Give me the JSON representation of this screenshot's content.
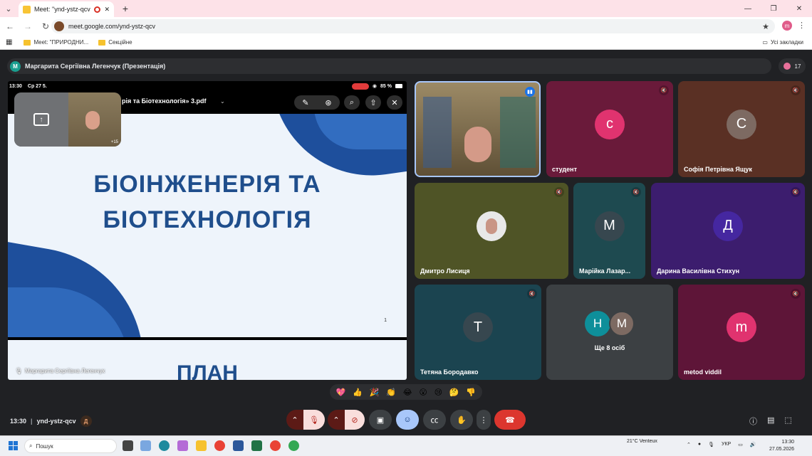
{
  "browser": {
    "tab_title": "Meet: \"ynd-ystz-qcv\"",
    "url": "meet.google.com/ynd-ystz-qcv",
    "profile_initial": "m",
    "bookmarks": [
      {
        "label": "Meet: \"ПРИРОДНИ..."
      },
      {
        "label": "Секційне"
      }
    ],
    "all_bookmarks": "Усі закладки"
  },
  "meet": {
    "presenter_bar": "Маргарита Сергіївна Легенчук (Презентація)",
    "presenter_initial": "M",
    "participant_count": "17",
    "shared_screen": {
      "status_time": "13:30",
      "status_date": "Ср 27 5.",
      "battery": "85 %",
      "doc_name": "рія та Біотехнологія» 3.pdf",
      "slide_title_1": "БІОІНЖЕНЕРІЯ ТА",
      "slide_title_2": "БІОТЕХНОЛОГІЯ",
      "page_number": "1",
      "next_slide_title": "ПЛАН",
      "label": "Маргарита Сергіївна Легенчук",
      "pip_count": "+15"
    },
    "tiles": [
      {
        "name": "",
        "initial": "",
        "color": "#6b5a40"
      },
      {
        "name": "студент",
        "initial": "с",
        "color": "#6a1a3a",
        "av_color": "#e0336f"
      },
      {
        "name": "Софія Петрівна Ящук",
        "initial": "С",
        "color": "#5a3024",
        "av_color": "#7d6a62"
      },
      {
        "name": "Дмитро Лисиця",
        "initial": "",
        "color": "#4f5426"
      },
      {
        "name": "Марійка Лазар...",
        "initial": "М",
        "color": "#1e4a50",
        "av_color": "#37474f"
      },
      {
        "name": "Дарина Василівна Стихун",
        "initial": "Д",
        "color": "#3c1d6e",
        "av_color": "#4527a0"
      },
      {
        "name": "Тетяна Бородавко",
        "initial": "Т",
        "color": "#1b4450",
        "av_color": "#37474f"
      },
      {
        "name": "Ще 8 осіб",
        "initial": "",
        "color": "#3c4043"
      },
      {
        "name": "metod viddil",
        "initial": "m",
        "color": "#5e1538",
        "av_color": "#e0336f"
      }
    ],
    "more_avatars": [
      "Н",
      "М"
    ],
    "emojis": [
      "💖",
      "👍",
      "🎉",
      "👏",
      "😂",
      "😮",
      "😢",
      "🤔",
      "👎"
    ],
    "meeting_time": "13:30",
    "meeting_code": "ynd-ystz-qcv",
    "meeting_badge": "Д"
  },
  "taskbar": {
    "search": "Пошук",
    "weather": "21°C Venteux",
    "lang": "УКР",
    "time": "13:30",
    "date": "27.05.2026"
  }
}
